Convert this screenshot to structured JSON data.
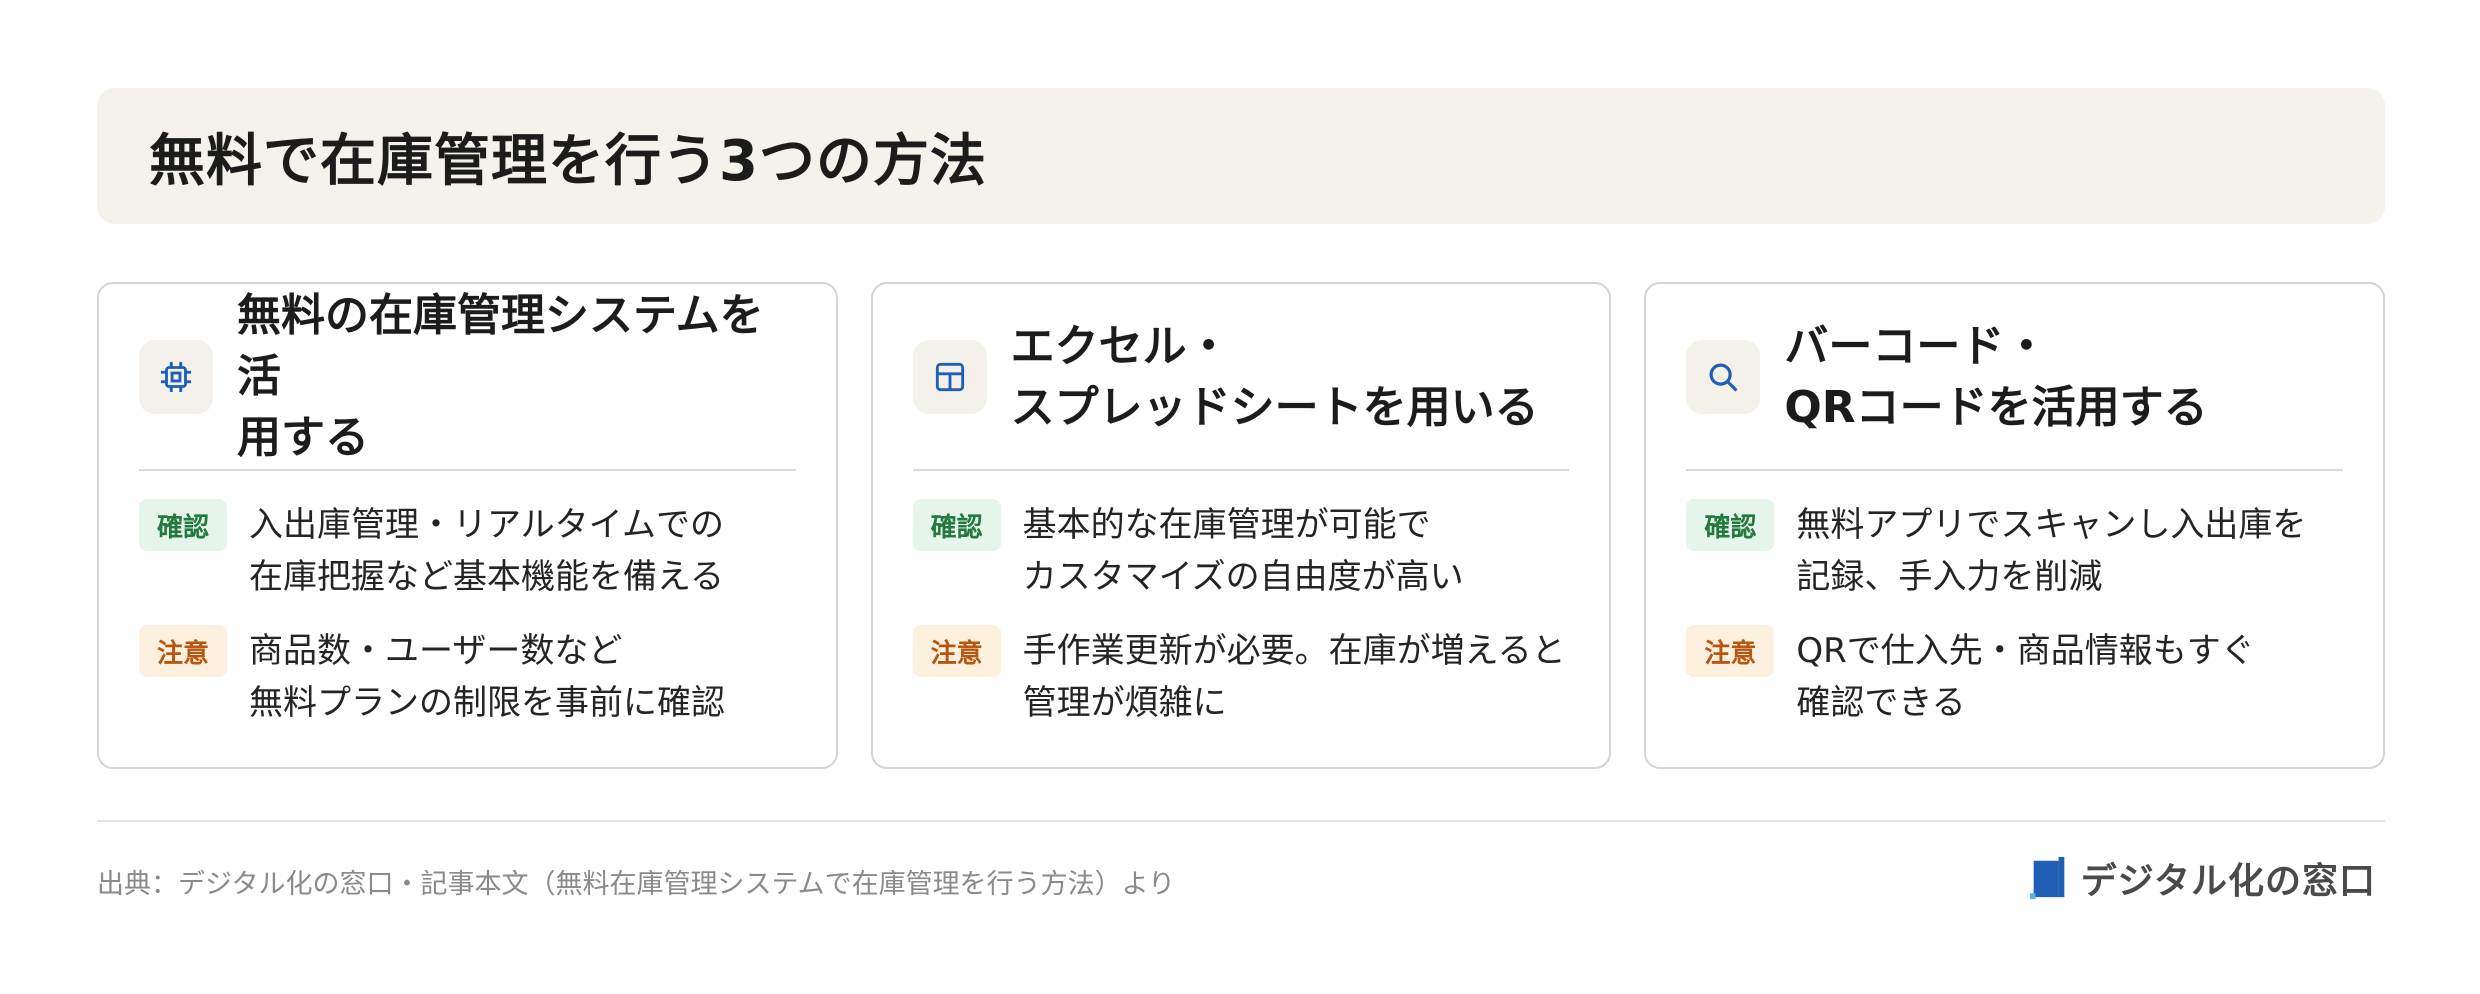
{
  "header": {
    "title": "無料で在庫管理を行う3つの方法"
  },
  "cards": [
    {
      "icon": "chip-icon",
      "title": "無料の在庫管理システムを活\n用する",
      "confirm_label": "確認",
      "confirm_text": "入出庫管理・リアルタイムでの\n在庫把握など基本機能を備える",
      "caution_label": "注意",
      "caution_text": "商品数・ユーザー数など\n無料プランの制限を事前に確認"
    },
    {
      "icon": "table-icon",
      "title": "エクセル・\nスプレッドシートを用いる",
      "confirm_label": "確認",
      "confirm_text": "基本的な在庫管理が可能で\nカスタマイズの自由度が高い",
      "caution_label": "注意",
      "caution_text": "手作業更新が必要。在庫が増えると\n管理が煩雑に"
    },
    {
      "icon": "search-icon",
      "title": "バーコード・\nQRコードを活用する",
      "confirm_label": "確認",
      "confirm_text": "無料アプリでスキャンし入出庫を\n記録、手入力を削減",
      "caution_label": "注意",
      "caution_text": "QRで仕入先・商品情報もすぐ\n確認できる"
    }
  ],
  "footer": {
    "source": "出典：デジタル化の窓口・記事本文（無料在庫管理システムで在庫管理を行う方法）より",
    "brand": "デジタル化の窓口"
  },
  "colors": {
    "accent_blue": "#1f5fb5",
    "confirm_bg": "#e5f5ea",
    "confirm_fg": "#237a3e",
    "caution_bg": "#fdf0de",
    "caution_fg": "#b8560f",
    "title_bg": "#f5f2ec"
  }
}
